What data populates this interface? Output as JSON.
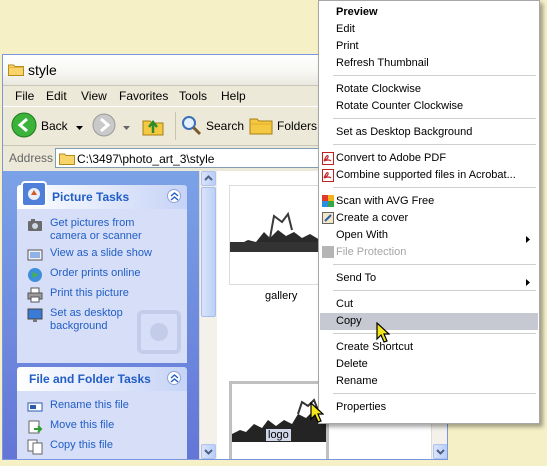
{
  "window": {
    "title": "style",
    "menus": [
      "File",
      "Edit",
      "View",
      "Favorites",
      "Tools",
      "Help"
    ],
    "toolbar": {
      "back": "Back",
      "search": "Search",
      "folders": "Folders"
    },
    "address_label": "Address",
    "address_value": "C:\\3497\\photo_art_3\\style"
  },
  "task_pane": {
    "picture_tasks": {
      "title": "Picture Tasks",
      "items": [
        "Get pictures from camera or scanner",
        "View as a slide show",
        "Order prints online",
        "Print this picture",
        "Set as desktop background"
      ]
    },
    "file_folder_tasks": {
      "title": "File and Folder Tasks",
      "items": [
        "Rename this file",
        "Move this file",
        "Copy this file"
      ]
    }
  },
  "files": [
    {
      "name": "gallery",
      "selected": false
    },
    {
      "name": "logo",
      "selected": true
    }
  ],
  "context_menu": {
    "items": [
      {
        "label": "Preview",
        "bold": true
      },
      {
        "label": "Edit"
      },
      {
        "label": "Print"
      },
      {
        "label": "Refresh Thumbnail"
      },
      {
        "label": "Rotate Clockwise"
      },
      {
        "label": "Rotate Counter Clockwise"
      },
      {
        "label": "Set as Desktop Background"
      },
      {
        "label": "Convert to Adobe PDF",
        "icon": "pdf-icon"
      },
      {
        "label": "Combine supported files in Acrobat...",
        "icon": "acrobat-combine-icon"
      },
      {
        "label": "Scan with AVG Free",
        "icon": "avg-icon"
      },
      {
        "label": "Create a cover",
        "icon": "cover-icon"
      },
      {
        "label": "Open With",
        "submenu": true
      },
      {
        "label": "File Protection",
        "disabled": true,
        "icon": "protection-icon"
      },
      {
        "label": "Send To",
        "submenu": true
      },
      {
        "label": "Cut"
      },
      {
        "label": "Copy",
        "highlighted": true
      },
      {
        "label": "Create Shortcut"
      },
      {
        "label": "Delete"
      },
      {
        "label": "Rename"
      },
      {
        "label": "Properties"
      }
    ]
  },
  "colors": {
    "desktop": "#f6f0c7",
    "task_pane": "#6f8ee0",
    "task_link": "#215dc6",
    "menu_highlight": "#c6c9d2"
  }
}
